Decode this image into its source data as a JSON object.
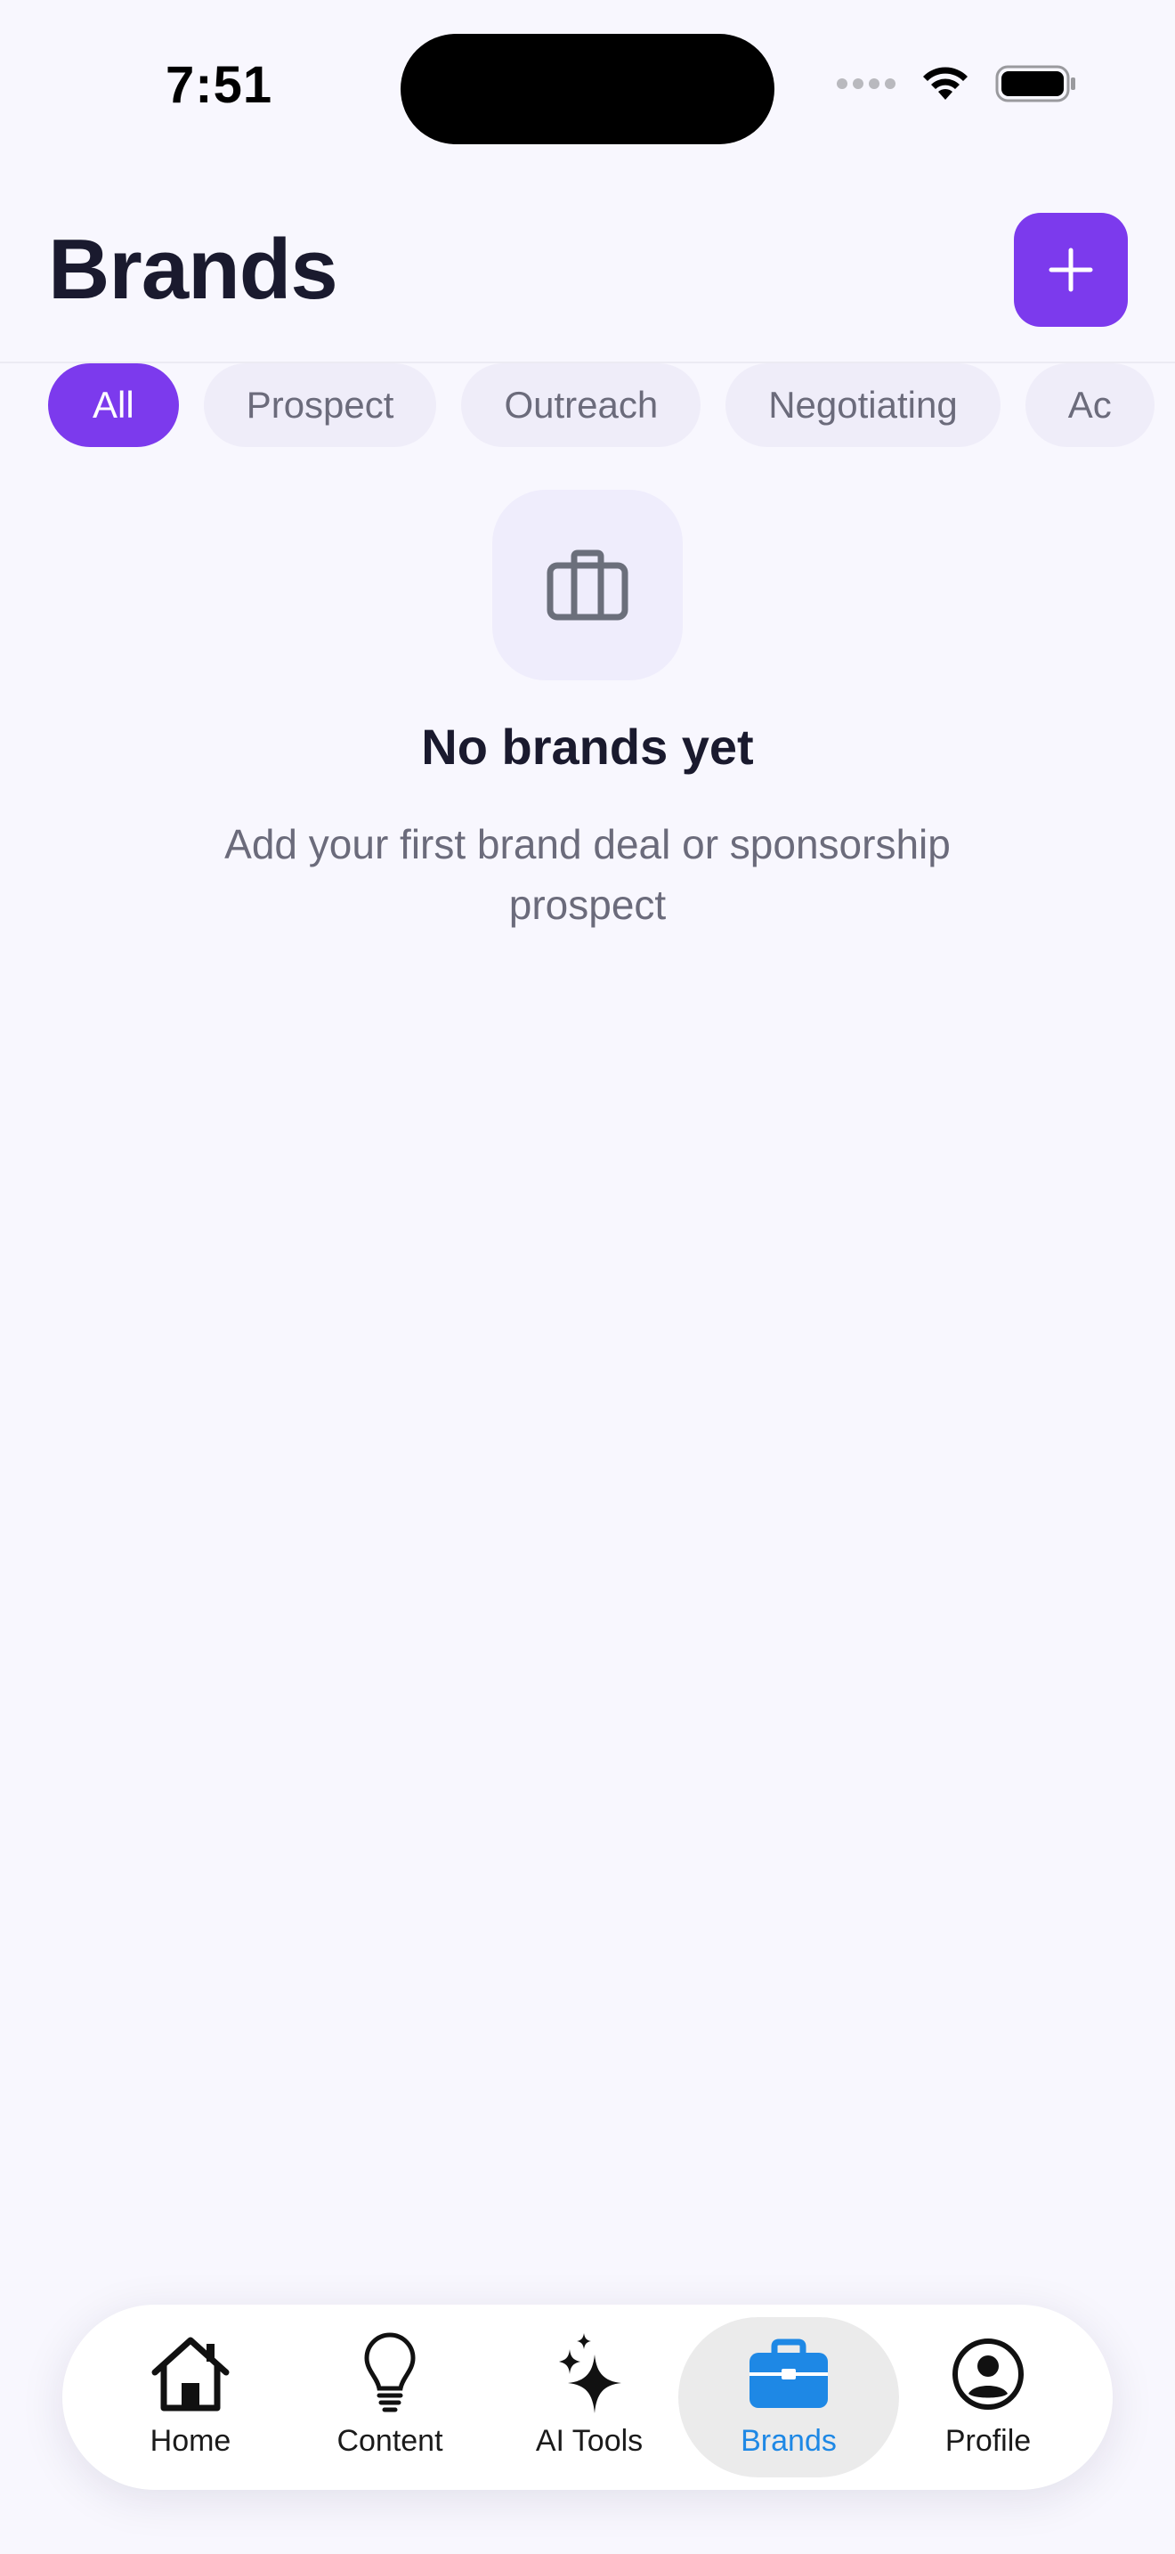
{
  "status_bar": {
    "time": "7:51"
  },
  "header": {
    "title": "Brands"
  },
  "filters": [
    {
      "label": "All",
      "active": true
    },
    {
      "label": "Prospect",
      "active": false
    },
    {
      "label": "Outreach",
      "active": false
    },
    {
      "label": "Negotiating",
      "active": false
    },
    {
      "label": "Ac",
      "active": false
    }
  ],
  "empty_state": {
    "icon": "briefcase-icon",
    "title": "No brands yet",
    "subtitle": "Add your first brand deal or sponsorship prospect"
  },
  "tab_bar": {
    "items": [
      {
        "label": "Home",
        "icon": "home-icon",
        "active": false
      },
      {
        "label": "Content",
        "icon": "lightbulb-icon",
        "active": false
      },
      {
        "label": "AI Tools",
        "icon": "sparkles-icon",
        "active": false
      },
      {
        "label": "Brands",
        "icon": "briefcase-icon",
        "active": true
      },
      {
        "label": "Profile",
        "icon": "profile-icon",
        "active": false
      }
    ]
  },
  "colors": {
    "accent": "#7C3AED",
    "active_tab": "#1E88E5",
    "background": "#F8F7FE",
    "chip_bg": "#EFEDF9",
    "muted_text": "#6B6B7B"
  }
}
